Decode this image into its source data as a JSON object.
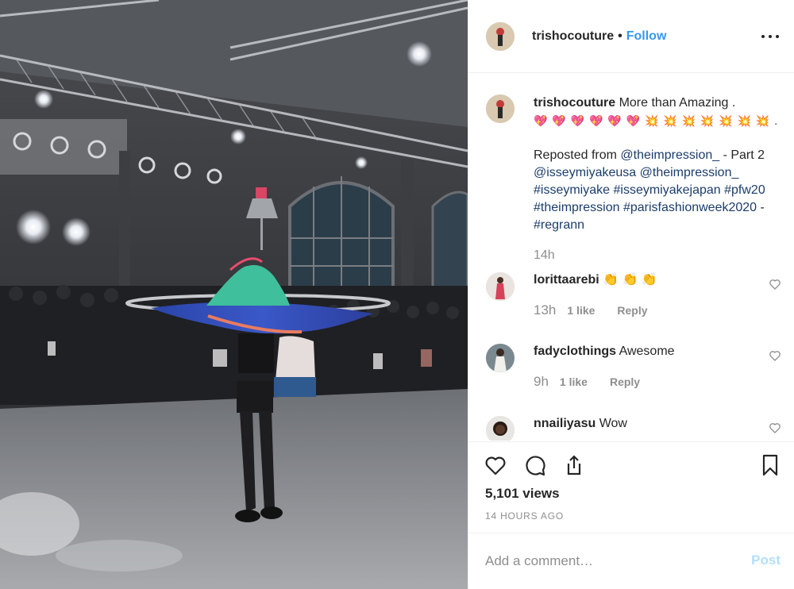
{
  "post": {
    "username": "trishocouture",
    "separator": "•",
    "follow_label": "Follow",
    "more_icon": "more-horizontal-icon"
  },
  "caption": {
    "username": "trishocouture",
    "text": "More than Amazing .",
    "emoji_hearts": "💖 💖 💖 💖 💖 💖",
    "emoji_booms": "💥 💥 💥 💥 💥 💥 💥",
    "emoji_tail": " .",
    "repost_prefix": "Reposted from ",
    "repost_user": "@theimpression_",
    "repost_mid": " - Part 2 ",
    "mention_1": "@isseymiyakeusa",
    "mention_2": "@theimpression_",
    "hashtag_1": "#isseymiyake",
    "hashtag_2": "#isseymiyakejapan",
    "hashtag_3": "#pfw20",
    "hashtag_4": "#theimpression",
    "hashtag_5": "#parisfashionweek2020",
    "tail_dash": " - ",
    "hashtag_6": "#regrann",
    "time": "14h"
  },
  "comments": [
    {
      "username": "lorittaarebi",
      "text": "👏 👏 👏",
      "time": "13h",
      "likes": "1 like",
      "reply": "Reply"
    },
    {
      "username": "fadyclothings",
      "text": "Awesome",
      "time": "9h",
      "likes": "1 like",
      "reply": "Reply"
    },
    {
      "username": "nnailiyasu",
      "text": "Wow",
      "time": "",
      "likes": "",
      "reply": ""
    }
  ],
  "actions": {
    "like_icon": "heart-icon",
    "comment_icon": "comment-icon",
    "share_icon": "share-icon",
    "save_icon": "bookmark-icon",
    "views": "5,101 views",
    "age": "14 HOURS AGO"
  },
  "add_comment": {
    "placeholder": "Add a comment…",
    "post_label": "Post"
  },
  "colors": {
    "link": "#1c3d6b",
    "follow": "#3897f0",
    "muted": "#8e8e8e",
    "post_disabled": "#b2dffc"
  }
}
